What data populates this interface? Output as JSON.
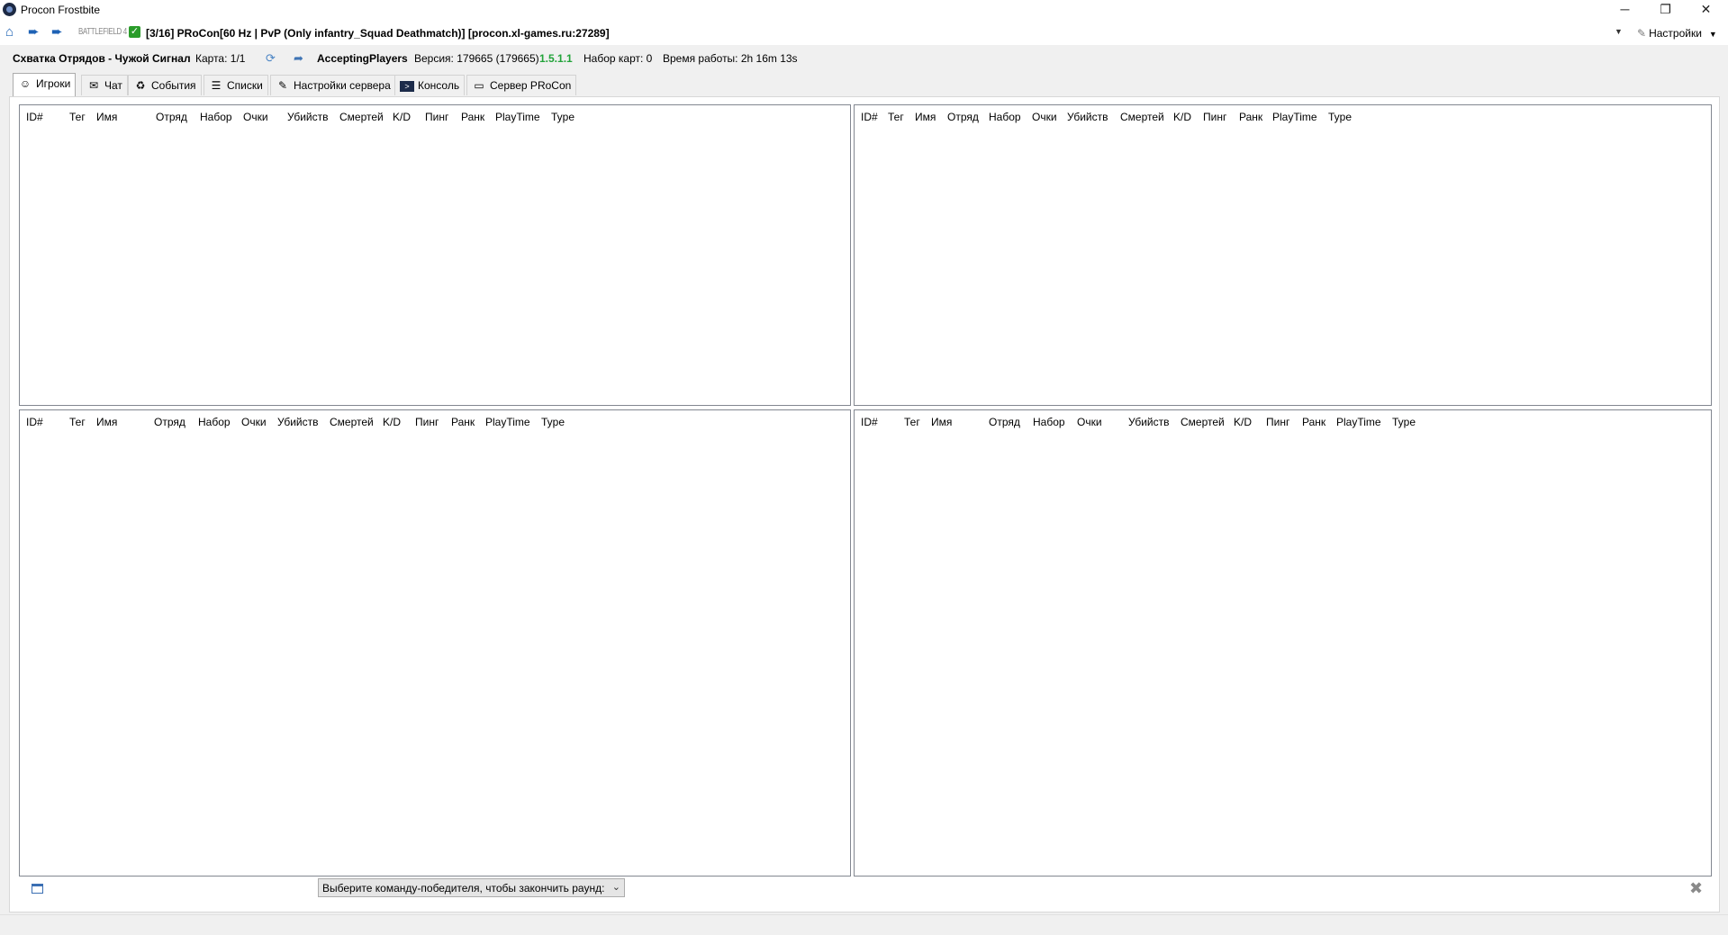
{
  "window": {
    "title": "Procon Frostbite",
    "minimize": "─",
    "restore": "❐",
    "close": "✕"
  },
  "toolbar": {
    "game_logo": "BATTLEFIELD 4",
    "server_title": "[3/16]  PRoCon[60 Hz | PvP (Only infantry_Squad Deathmatch)] [procon.xl-games.ru:27289]",
    "settings_label": "Настройки"
  },
  "status": {
    "mode": "Схватка Отрядов - Чужой Сигнал",
    "map": "Карта: 1/1",
    "state": "AcceptingPlayers",
    "version": "Версия: 179665 (179665)",
    "procon_version": "1.5.1.1",
    "mapset": "Набор карт: 0",
    "uptime": "Время работы: 2h 16m 13s"
  },
  "tabs": [
    {
      "label": "Игроки",
      "icon": "players-icon"
    },
    {
      "label": "Чат",
      "icon": "chat-icon"
    },
    {
      "label": "События",
      "icon": "events-icon"
    },
    {
      "label": "Списки",
      "icon": "lists-icon"
    },
    {
      "label": "Настройки сервера",
      "icon": "server-settings-icon"
    },
    {
      "label": "Консоль",
      "icon": "console-icon"
    },
    {
      "label": "Сервер PRoCon",
      "icon": "procon-server-icon"
    }
  ],
  "columns": [
    "ID#",
    "Тег",
    "Имя",
    "Отряд",
    "Набор",
    "Очки",
    "Убийств",
    "Смертей",
    "K/D",
    "Пинг",
    "Ранк",
    "PlayTime",
    "Type"
  ],
  "bottom": {
    "winner_select": "Выберите команду-победителя, чтобы закончить раунд:"
  }
}
